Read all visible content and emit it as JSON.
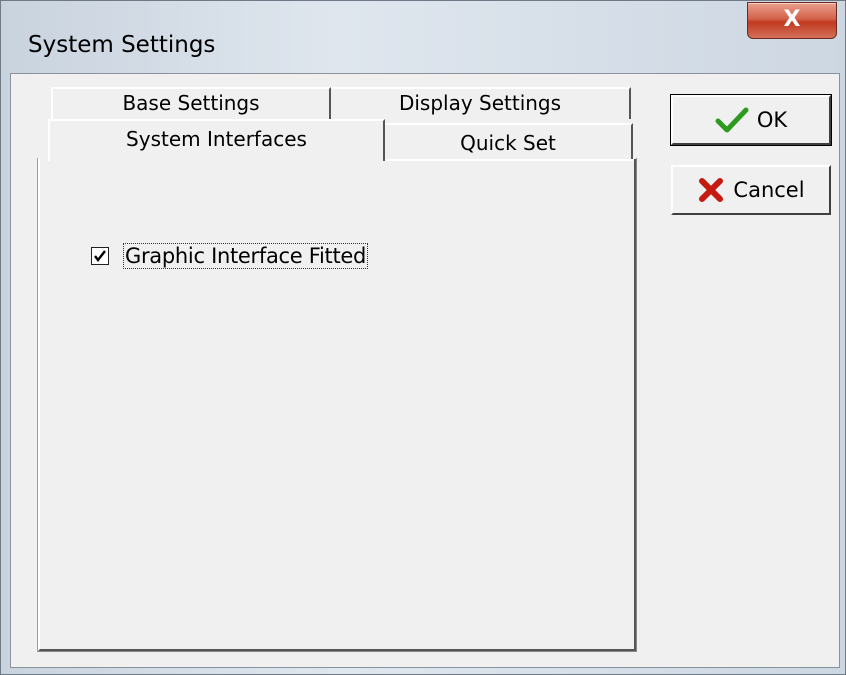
{
  "window": {
    "title": "System Settings",
    "close_label": "X"
  },
  "tabs": [
    {
      "label": "Base Settings",
      "active": false
    },
    {
      "label": "Display Settings",
      "active": false
    },
    {
      "label": "System Interfaces",
      "active": true
    },
    {
      "label": "Quick Set",
      "active": false
    }
  ],
  "panel": {
    "checkbox_label": "Graphic Interface Fitted",
    "checked": true
  },
  "buttons": {
    "ok_label": "OK",
    "ok_icon": "checkmark-icon",
    "cancel_label": "Cancel",
    "cancel_icon": "red-x-icon"
  },
  "colors": {
    "ok_icon": "#2e9a1f",
    "cancel_icon": "#c41a10",
    "close_button": "#c8442b"
  }
}
